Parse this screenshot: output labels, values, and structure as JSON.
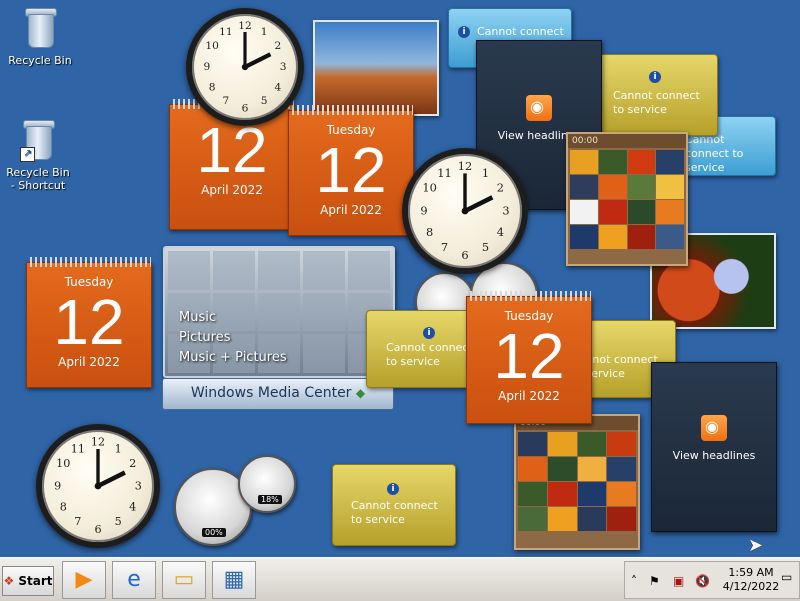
{
  "desktop": {
    "icons": [
      {
        "label": "Recycle Bin",
        "icon": "recycle-bin-icon"
      },
      {
        "label": "Recycle Bin - Shortcut",
        "icon": "recycle-bin-icon"
      }
    ]
  },
  "calendars": [
    {
      "dow": "",
      "day": "12",
      "month": "April 2022"
    },
    {
      "dow": "Tuesday",
      "day": "12",
      "month": "April 2022"
    },
    {
      "dow": "Tuesday",
      "day": "12",
      "month": "April 2022"
    },
    {
      "dow": "Tuesday",
      "day": "12",
      "month": "April 2022"
    }
  ],
  "feeds": {
    "label": "View headlines"
  },
  "weather": {
    "message": "Cannot connect to service",
    "info": "i"
  },
  "media_center": {
    "menu": [
      "Music",
      "Pictures",
      "Music + Pictures"
    ],
    "brand": "Windows Media Center"
  },
  "puzzle": {
    "timer": "00:00"
  },
  "meters": {
    "cpu": "00%",
    "ram": "18%"
  },
  "taskbar": {
    "start_label": "Start",
    "time": "1:59 AM",
    "date": "4/12/2022"
  },
  "colors": {
    "desktop": "#2f64a6",
    "calendar": "#d95c16",
    "weather": "#c9b43c"
  }
}
